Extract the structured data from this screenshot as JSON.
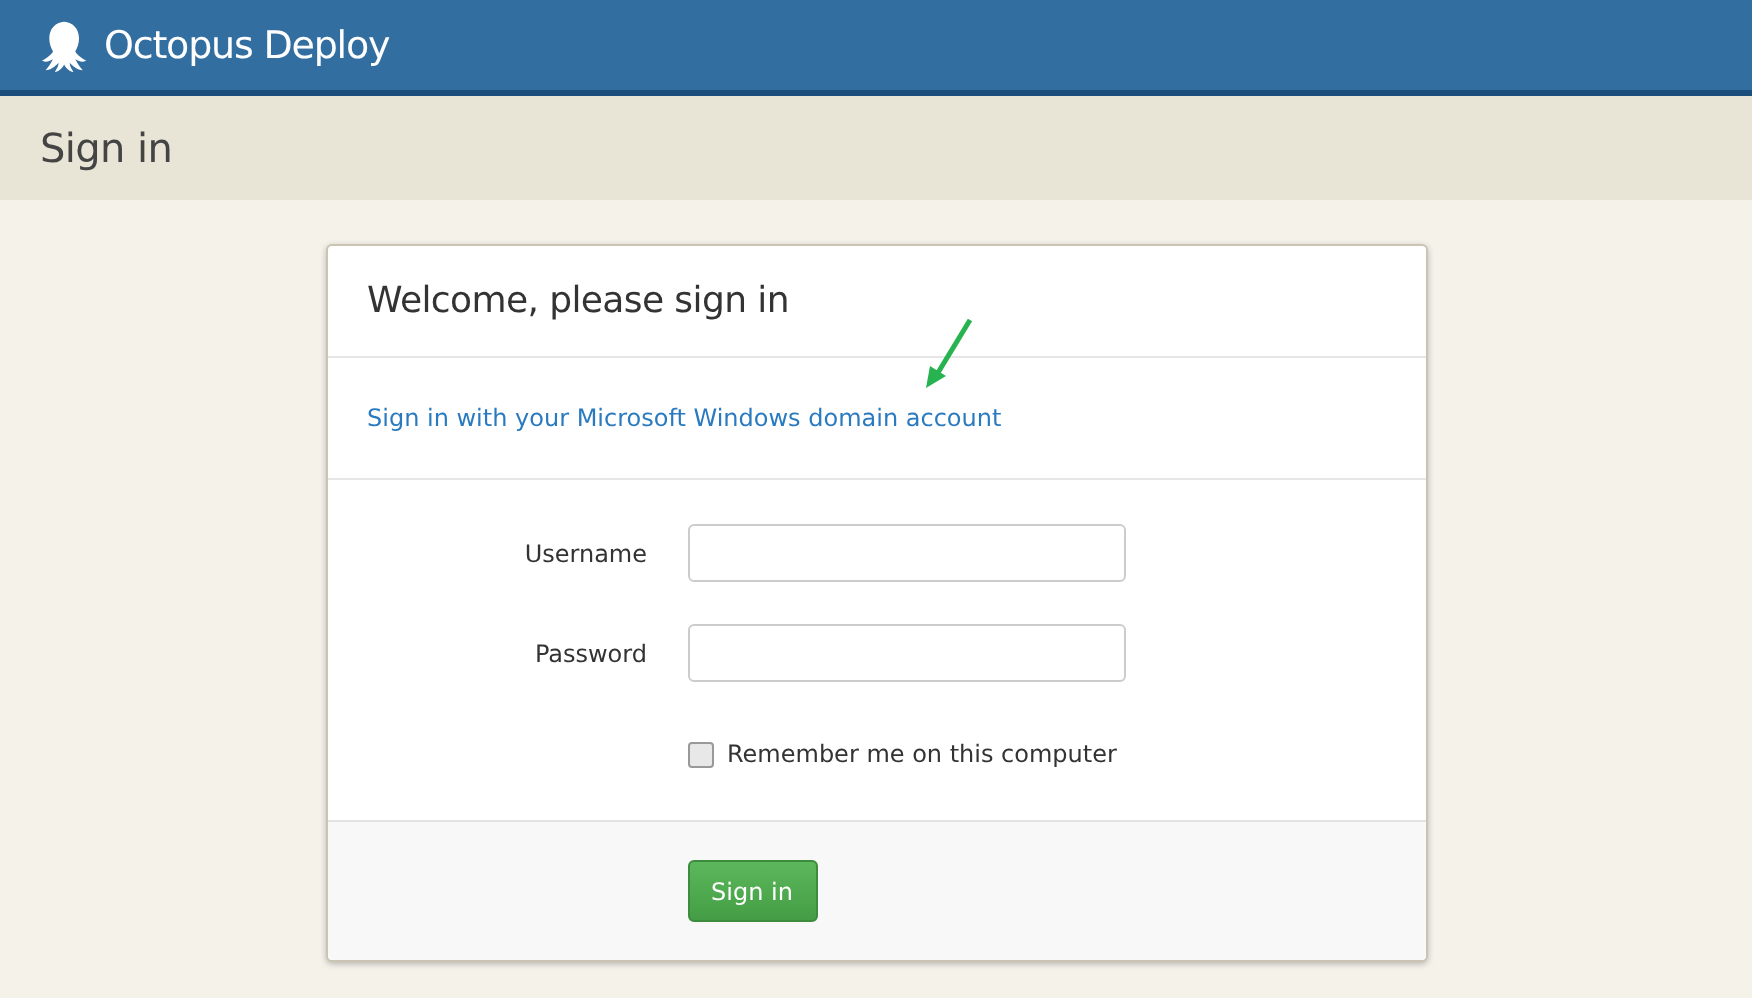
{
  "header": {
    "brand": "Octopus Deploy"
  },
  "page_title": "Sign in",
  "card": {
    "title": "Welcome, please sign in",
    "windows_link": "Sign in with your Microsoft Windows domain account",
    "fields": [
      {
        "label": "Username"
      },
      {
        "label": "Password"
      }
    ],
    "remember": {
      "label": "Remember me on this computer",
      "checked": false
    },
    "submit_button": "Sign in"
  }
}
